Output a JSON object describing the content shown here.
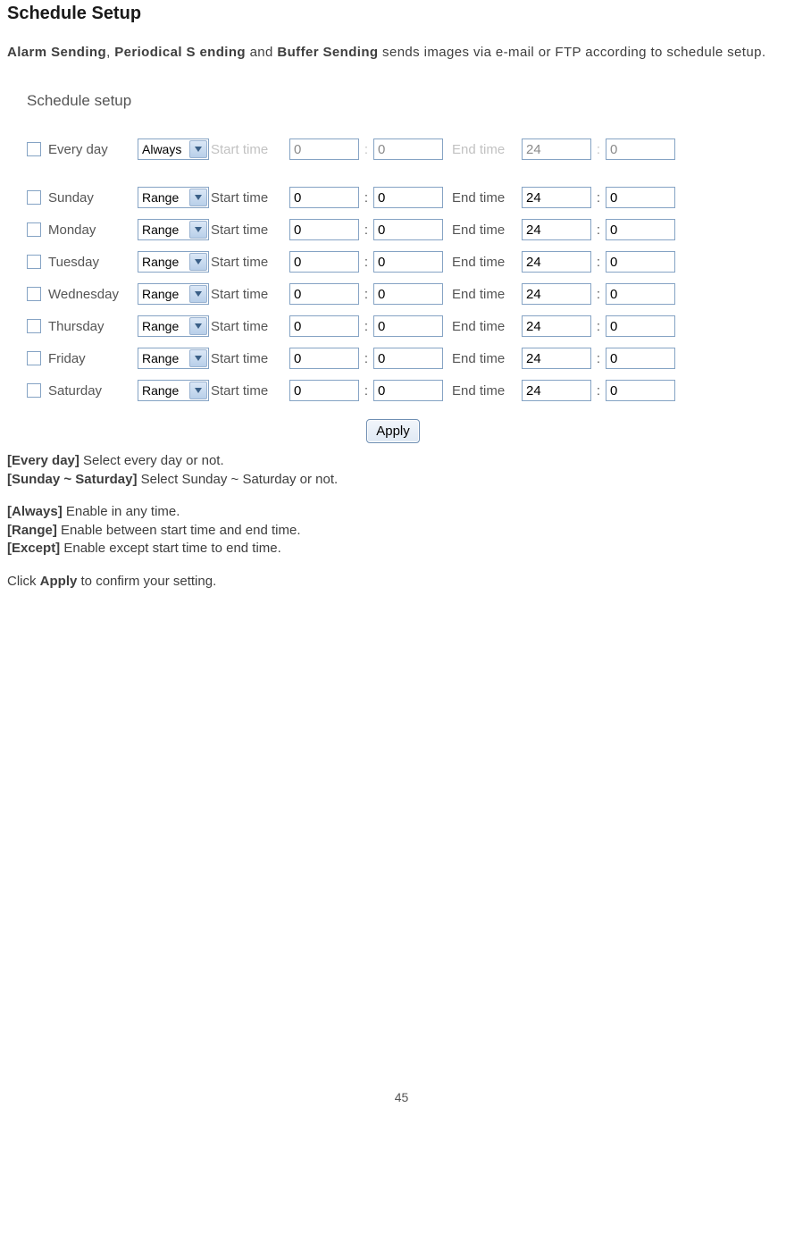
{
  "title": "Schedule Setup",
  "intro": {
    "bold1": "Alarm Sending",
    "sep1": ", ",
    "bold2": "Periodical S ending",
    "sep2": " and ",
    "bold3": "Buffer Sending",
    "rest": " sends images via e-mail or FTP according to schedule setup."
  },
  "form": {
    "heading": "Schedule setup",
    "labels": {
      "start_time": "Start time",
      "end_time": "End time"
    },
    "everyday": {
      "label": "Every day",
      "mode": "Always",
      "start_h": "0",
      "start_m": "0",
      "end_h": "24",
      "end_m": "0"
    },
    "days": [
      {
        "label": "Sunday",
        "mode": "Range",
        "start_h": "0",
        "start_m": "0",
        "end_h": "24",
        "end_m": "0"
      },
      {
        "label": "Monday",
        "mode": "Range",
        "start_h": "0",
        "start_m": "0",
        "end_h": "24",
        "end_m": "0"
      },
      {
        "label": "Tuesday",
        "mode": "Range",
        "start_h": "0",
        "start_m": "0",
        "end_h": "24",
        "end_m": "0"
      },
      {
        "label": "Wednesday",
        "mode": "Range",
        "start_h": "0",
        "start_m": "0",
        "end_h": "24",
        "end_m": "0"
      },
      {
        "label": "Thursday",
        "mode": "Range",
        "start_h": "0",
        "start_m": "0",
        "end_h": "24",
        "end_m": "0"
      },
      {
        "label": "Friday",
        "mode": "Range",
        "start_h": "0",
        "start_m": "0",
        "end_h": "24",
        "end_m": "0"
      },
      {
        "label": "Saturday",
        "mode": "Range",
        "start_h": "0",
        "start_m": "0",
        "end_h": "24",
        "end_m": "0"
      }
    ],
    "apply": "Apply"
  },
  "descriptions": {
    "every_day_k": "[Every day]",
    "every_day_v": " Select every day or not.",
    "sun_sat_k": "[Sunday ~ Saturday]",
    "sun_sat_v": " Select Sunday ~ Saturday or not.",
    "always_k": "[Always]",
    "always_v": " Enable in any time.",
    "range_k": "[Range]",
    "range_v": " Enable between start time and end time.",
    "except_k": "[Except]",
    "except_v": " Enable except start time to end time.",
    "click_pre": "Click ",
    "click_k": "Apply",
    "click_post": " to confirm your setting."
  },
  "page_number": "45"
}
